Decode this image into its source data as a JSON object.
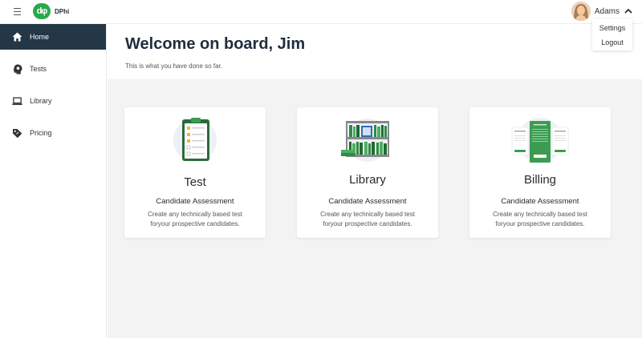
{
  "brand": {
    "logo_mark": "dφ",
    "name": "DPhi"
  },
  "user": {
    "name": "Adams",
    "menu": [
      {
        "label": "Settings"
      },
      {
        "label": "Logout"
      }
    ]
  },
  "sidebar": {
    "items": [
      {
        "label": "Home",
        "icon": "home-icon",
        "active": true
      },
      {
        "label": "Tests",
        "icon": "head-icon",
        "active": false
      },
      {
        "label": "Library",
        "icon": "laptop-icon",
        "active": false
      },
      {
        "label": "Pricing",
        "icon": "tag-icon",
        "active": false
      }
    ]
  },
  "header": {
    "title": "Welcome on board, Jim",
    "subtitle": "This is what you have done so far."
  },
  "cards": [
    {
      "title": "Test",
      "subtitle": "Candidate Assessment",
      "description": "Create any technically based test foryour prospective candidates.",
      "illustration": "clipboard-checklist-illustration"
    },
    {
      "title": "Library",
      "subtitle": "Candidate Assessment",
      "description": "Create any technically based test foryour prospective candidates.",
      "illustration": "bookshelf-illustration"
    },
    {
      "title": "Billing",
      "subtitle": "Candidate Assessment",
      "description": "Create any technically based test foryour prospective candidates.",
      "illustration": "pricing-plans-illustration"
    }
  ],
  "colors": {
    "sidebar_active": "#233746",
    "brand_green": "#2aa84a",
    "title": "#1f2d3d",
    "content_bg": "#f3f3f3"
  }
}
